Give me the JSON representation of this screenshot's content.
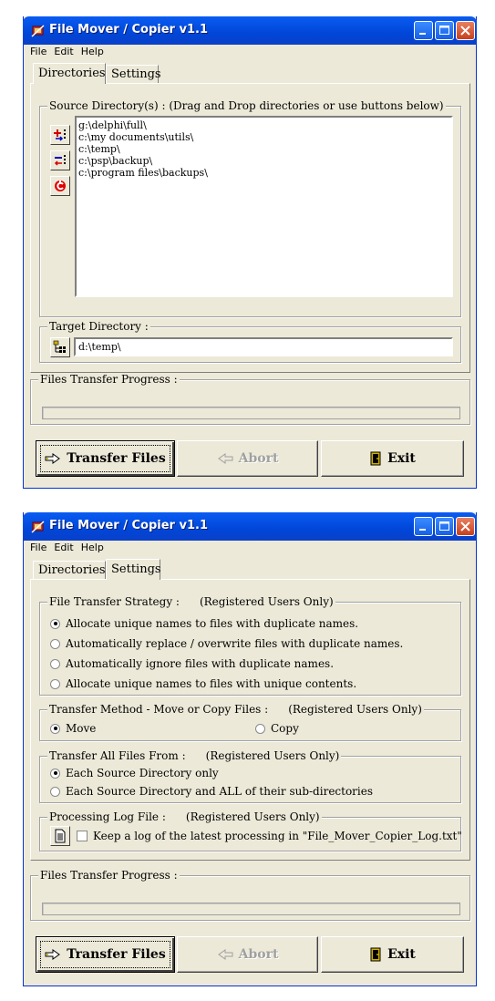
{
  "window": {
    "title": "File Mover / Copier v1.1"
  },
  "menu": {
    "file": "File",
    "edit": "Edit",
    "help": "Help"
  },
  "tabs": {
    "directories": "Directories",
    "settings": "Settings"
  },
  "directories": {
    "source_label": "Source Directory(s) : (Drag and Drop directories or use buttons below)",
    "source_items": [
      "g:\\delphi\\full\\",
      "c:\\my documents\\utils\\",
      "c:\\temp\\",
      "c:\\psp\\backup\\",
      "c:\\program files\\backups\\"
    ],
    "target_label": "Target Directory :",
    "target_value": "d:\\temp\\"
  },
  "settings": {
    "strategy_label": "File Transfer Strategy :",
    "strategy_note": "(Registered Users Only)",
    "strategy_options": [
      "Allocate unique names to files with duplicate names.",
      "Automatically replace / overwrite  files with duplicate names.",
      "Automatically ignore files with duplicate names.",
      "Allocate unique names to files with unique contents."
    ],
    "method_label": "Transfer Method - Move or Copy Files :",
    "method_note": "(Registered Users Only)",
    "method_move": "Move",
    "method_copy": "Copy",
    "from_label": "Transfer All Files From :",
    "from_note": "(Registered Users Only)",
    "from_options": [
      "Each Source Directory only",
      "Each Source Directory and ALL of their sub-directories"
    ],
    "log_label": "Processing Log File :",
    "log_note": "(Registered Users Only)",
    "log_checkbox": "Keep a log of the latest processing in \"File_Mover_Copier_Log.txt\""
  },
  "progress": {
    "label": "Files Transfer Progress :",
    "value": 0
  },
  "buttons": {
    "transfer": "Transfer Files",
    "abort": "Abort",
    "exit": "Exit"
  }
}
